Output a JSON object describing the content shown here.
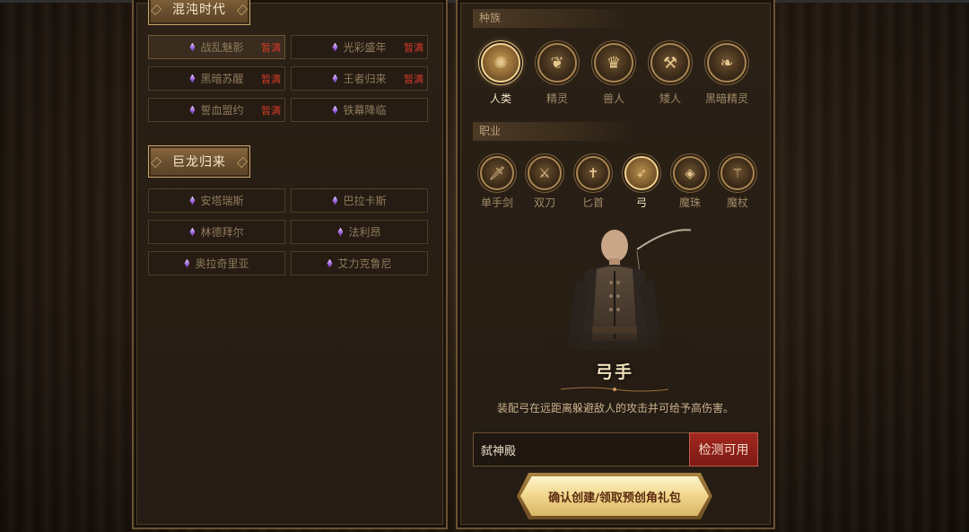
{
  "server_groups": [
    {
      "title": "混沌时代",
      "servers": [
        {
          "name": "战乱魅影",
          "status": "暂满",
          "selected": true
        },
        {
          "name": "光彩盛年",
          "status": "暂满"
        },
        {
          "name": "黑暗苏醒",
          "status": "暂满"
        },
        {
          "name": "王者归来",
          "status": "暂满"
        },
        {
          "name": "誓血盟约",
          "status": "暂满"
        },
        {
          "name": "铁幕降临",
          "status": ""
        }
      ]
    },
    {
      "title": "巨龙归来",
      "servers": [
        {
          "name": "安塔瑞斯",
          "status": ""
        },
        {
          "name": "巴拉卡斯",
          "status": ""
        },
        {
          "name": "林德拜尔",
          "status": ""
        },
        {
          "name": "法利昂",
          "status": ""
        },
        {
          "name": "奥拉奇里亚",
          "status": ""
        },
        {
          "name": "艾力克鲁尼",
          "status": ""
        }
      ]
    }
  ],
  "race": {
    "header": "种族",
    "selected": "人类",
    "options": [
      {
        "label": "人类",
        "icon": "human-emblem-icon"
      },
      {
        "label": "精灵",
        "icon": "elf-emblem-icon"
      },
      {
        "label": "兽人",
        "icon": "orc-emblem-icon"
      },
      {
        "label": "矮人",
        "icon": "dwarf-emblem-icon"
      },
      {
        "label": "黑暗精灵",
        "icon": "dark-elf-emblem-icon"
      }
    ]
  },
  "class": {
    "header": "职业",
    "selected": "弓",
    "options": [
      {
        "label": "单手剑",
        "icon": "sword-icon"
      },
      {
        "label": "双刀",
        "icon": "dual-blades-icon"
      },
      {
        "label": "匕首",
        "icon": "dagger-icon"
      },
      {
        "label": "弓",
        "icon": "bow-icon"
      },
      {
        "label": "魔珠",
        "icon": "orb-icon"
      },
      {
        "label": "魔杖",
        "icon": "staff-icon"
      }
    ]
  },
  "character": {
    "title": "弓手",
    "description": "装配弓在远距离躲避敌人的攻击并可给予高伤害。"
  },
  "name_form": {
    "value": "弑神殿",
    "check_label": "检测可用"
  },
  "confirm_label": "确认创建/领取预创角礼包",
  "colors": {
    "status_full": "#d23a2a",
    "gold": "#f2d98f",
    "check_red": "#8f2018"
  }
}
